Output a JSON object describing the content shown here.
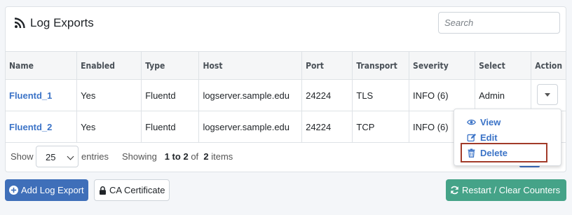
{
  "panel": {
    "title": "Log Exports",
    "icon": "rss-icon"
  },
  "search": {
    "placeholder": "Search"
  },
  "table": {
    "headers": [
      "Name",
      "Enabled",
      "Type",
      "Host",
      "Port",
      "Transport",
      "Severity",
      "Select",
      "Action"
    ],
    "rows": [
      {
        "name": "Fluentd_1",
        "enabled": "Yes",
        "type": "Fluentd",
        "host": "logserver.sample.edu",
        "port": "24224",
        "transport": "TLS",
        "severity": "INFO (6)",
        "select": "Admin"
      },
      {
        "name": "Fluentd_2",
        "enabled": "Yes",
        "type": "Fluentd",
        "host": "logserver.sample.edu",
        "port": "24224",
        "transport": "TCP",
        "severity": "INFO (6)",
        "select": ""
      }
    ]
  },
  "footer": {
    "show_label": "Show",
    "entries_value": "25",
    "entries_label": "entries",
    "showing_prefix": "Showing",
    "showing_range": "1 to 2",
    "showing_of": "of",
    "showing_total": "2",
    "showing_suffix": "items"
  },
  "action_menu": {
    "items": [
      {
        "label": "View",
        "icon": "eye-icon"
      },
      {
        "label": "Edit",
        "icon": "edit-icon"
      },
      {
        "label": "Delete",
        "icon": "trash-icon"
      }
    ]
  },
  "buttons": {
    "add_log_export": "Add Log Export",
    "ca_certificate": "CA Certificate",
    "restart_clear": "Restart / Clear Counters"
  },
  "colors": {
    "link": "#3b73c7",
    "primary": "#3f6fb9",
    "success": "#45a388",
    "highlight_border": "#a23b2a"
  }
}
